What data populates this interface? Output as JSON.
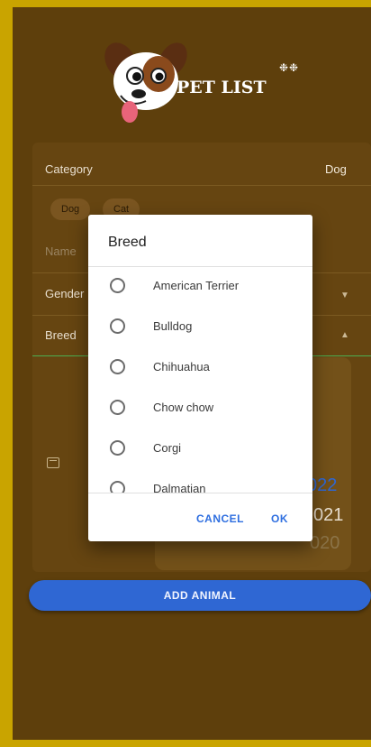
{
  "app": {
    "logo_text": "PET LIST"
  },
  "form": {
    "category_label": "Category",
    "category_value": "Dog",
    "chips": [
      "Dog",
      "Cat"
    ],
    "name_label": "Name",
    "gender_label": "Gender",
    "breed_label": "Breed",
    "picker_values": [
      "022",
      "021",
      "020"
    ],
    "add_button": "ADD ANIMAL"
  },
  "dialog": {
    "title": "Breed",
    "options": [
      "American Terrier",
      "Bulldog",
      "Chihuahua",
      "Chow chow",
      "Corgi",
      "Dalmatian"
    ],
    "cancel": "CANCEL",
    "ok": "OK"
  },
  "colors": {
    "background": "#5e3f0c",
    "border": "#c9a400",
    "accent": "#2f67d3",
    "dialog_action": "#2f6fe0",
    "active_underline": "#4caf50"
  }
}
